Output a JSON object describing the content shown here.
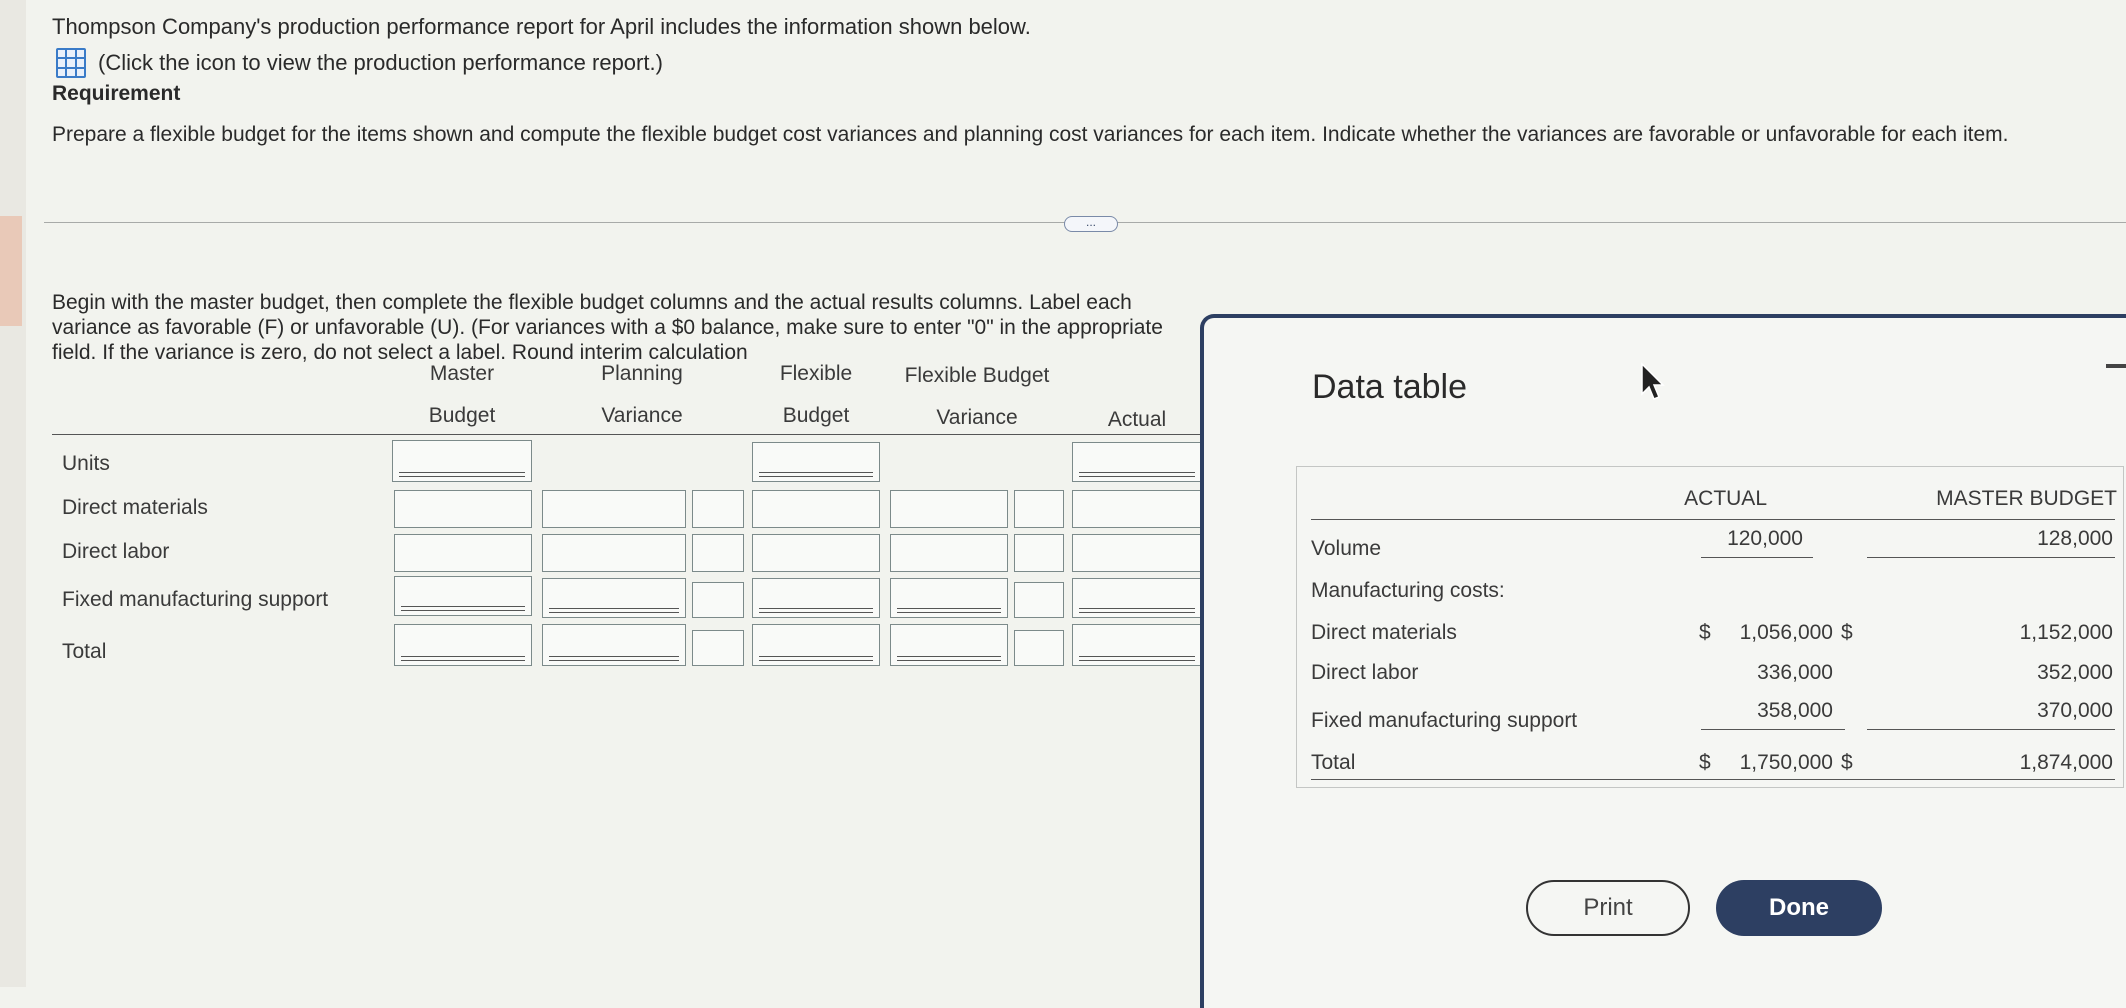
{
  "intro": "Thompson Company's production performance report for April includes the information shown below.",
  "click_text": "(Click the icon to view the production performance report.)",
  "requirement_heading": "Requirement",
  "requirement_text": "Prepare a flexible budget for the items shown and compute the flexible budget cost variances and planning cost variances for each item. Indicate whether the variances are favorable or unfavorable for each item.",
  "more_label": "...",
  "instructions": "Begin with the master budget, then complete the flexible budget columns and the actual results columns. Label each variance as favorable (F) or unfavorable (U). (For variances with a $0 balance, make sure to enter \"0\" in the appropriate field. If the variance is zero, do not select a label. Round interim calculation",
  "instructions_overflow": "each variance as favorable (F) or unfavorable (U). (For variances with a $0 balance, make",
  "table": {
    "headers": {
      "master_1": "Master",
      "master_2": "Budget",
      "planning_1": "Planning",
      "planning_2": "Variance",
      "flexible_1": "Flexible",
      "flexible_2": "Budget",
      "fbv_1": "Flexible Budget",
      "fbv_2": "Variance",
      "actual": "Actual"
    },
    "rows": [
      "Units",
      "Direct materials",
      "Direct labor",
      "Fixed manufacturing support",
      "Total"
    ]
  },
  "modal": {
    "title": "Data table",
    "col_actual": "ACTUAL",
    "col_master": "MASTER BUDGET",
    "volume_label": "Volume",
    "volume_actual": "120,000",
    "volume_master": "128,000",
    "costs_label": "Manufacturing costs:",
    "dm_label": "Direct materials",
    "dm_actual": "1,056,000",
    "dm_master": "1,152,000",
    "dl_label": "Direct labor",
    "dl_actual": "336,000",
    "dl_master": "352,000",
    "fms_label": "Fixed manufacturing support",
    "fms_actual": "358,000",
    "fms_master": "370,000",
    "total_label": "Total",
    "total_actual": "1,750,000",
    "total_master": "1,874,000",
    "dollar": "$",
    "print_label": "Print",
    "done_label": "Done"
  }
}
